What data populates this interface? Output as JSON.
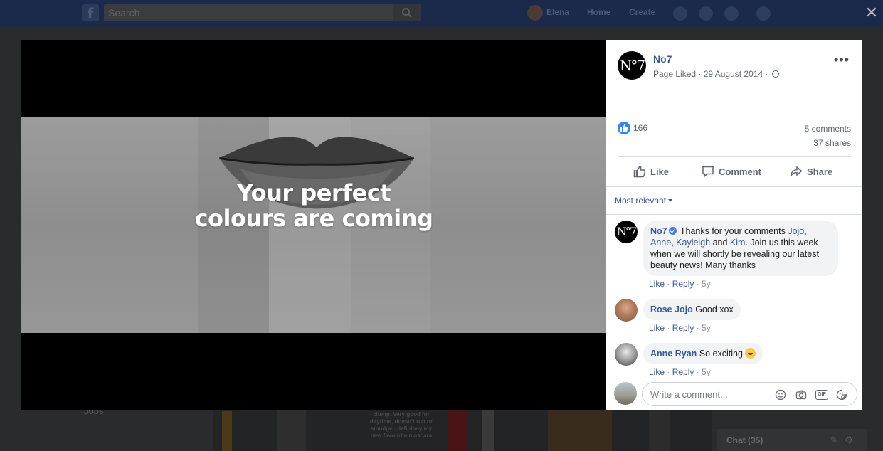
{
  "topbar": {
    "search_placeholder": "Search",
    "user_name": "Elena",
    "nav": [
      "Home",
      "Create"
    ]
  },
  "background": {
    "sidebar_item": "Jobs",
    "product_caption": "clump. Very good for daytime, doesn't run or smudge...definitely my new favourite mascara",
    "chat_label": "Chat (35)"
  },
  "media": {
    "headline_line1": "Your perfect",
    "headline_line2": "colours are coming"
  },
  "post": {
    "page_name": "No7",
    "logo_text": "N°7",
    "meta": "Page Liked · 29 August 2014 ·",
    "like_count": "166",
    "comments_count": "5 comments",
    "shares_count": "37 shares",
    "actions": {
      "like": "Like",
      "comment": "Comment",
      "share": "Share"
    },
    "sort_label": "Most relevant"
  },
  "comments": [
    {
      "author": "No7",
      "text_before": " Thanks for your comments ",
      "tags": [
        "Jojo",
        "Anne",
        "Kayleigh",
        "Kim"
      ],
      "text_after": ". Join us this week when we will shortly be revealing our latest beauty news! Many thanks",
      "like": "Like",
      "reply": "Reply",
      "time": "5y"
    },
    {
      "author": "Rose Jojo",
      "text": "Good xox",
      "like": "Like",
      "reply": "Reply",
      "time": "5y"
    },
    {
      "author": "Anne Ryan",
      "text": "So exciting",
      "like": "Like",
      "reply": "Reply",
      "time": "5y"
    }
  ],
  "composer": {
    "placeholder": "Write a comment...",
    "gif_label": "GIF"
  },
  "colors": {
    "link": "#385898",
    "like_blue": "#2d88ff",
    "overlay": "#2a2b2d"
  }
}
